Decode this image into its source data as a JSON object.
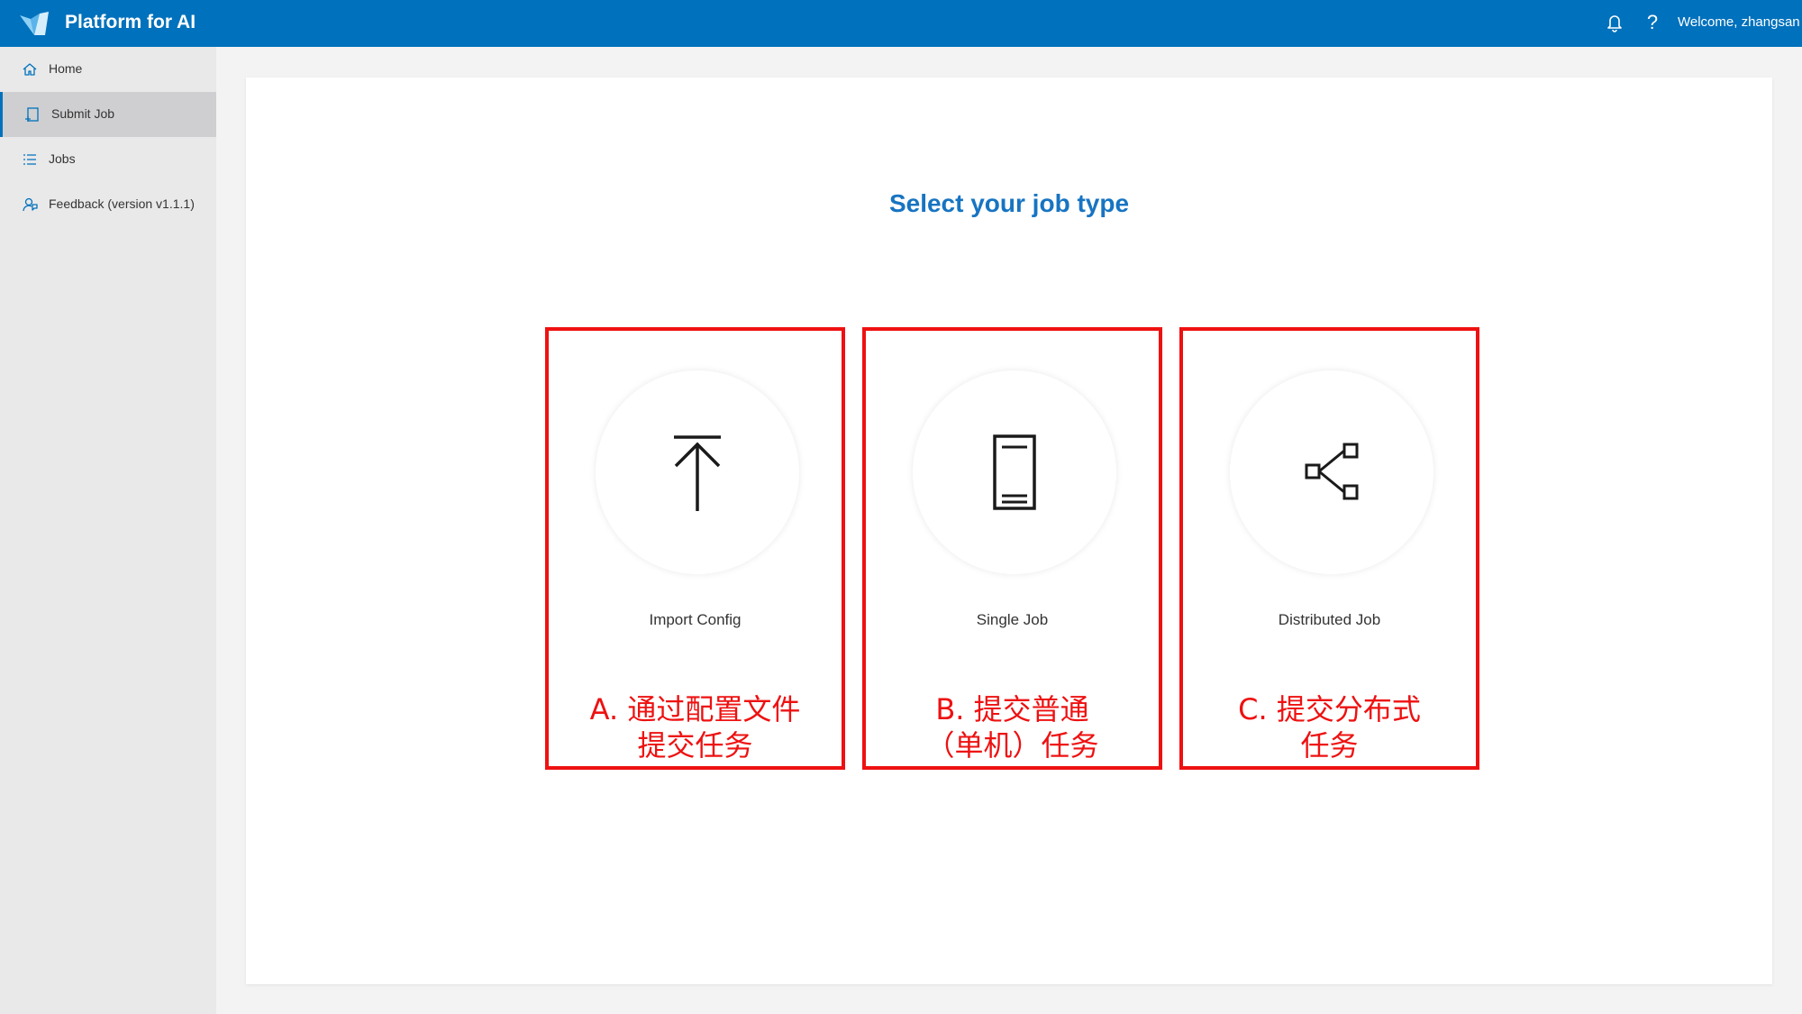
{
  "header": {
    "title": "Platform for AI",
    "help_glyph": "?",
    "welcome": "Welcome, zhangsan",
    "logo_icon": "platform-logo-icon",
    "notification_icon": "bell-icon",
    "brand_color": "#0071bc"
  },
  "sidebar": {
    "items": [
      {
        "label": "Home",
        "icon": "home-icon",
        "active": false
      },
      {
        "label": "Submit Job",
        "icon": "submit-job-icon",
        "active": true
      },
      {
        "label": "Jobs",
        "icon": "list-icon",
        "active": false
      },
      {
        "label": "Feedback (version v1.1.1)",
        "icon": "feedback-icon",
        "active": false
      }
    ]
  },
  "main": {
    "title": "Select your job type",
    "options": [
      {
        "label": "Import Config",
        "icon": "upload-icon",
        "annotation_line1": "A. 通过配置文件",
        "annotation_line2": "提交任务"
      },
      {
        "label": "Single Job",
        "icon": "single-job-icon",
        "annotation_line1": "B. 提交普通",
        "annotation_line2": "（单机）任务"
      },
      {
        "label": "Distributed Job",
        "icon": "distributed-job-icon",
        "annotation_line1": "C. 提交分布式",
        "annotation_line2": "任务"
      }
    ],
    "annotation_color": "#ee1111",
    "title_color": "#1774c2"
  }
}
